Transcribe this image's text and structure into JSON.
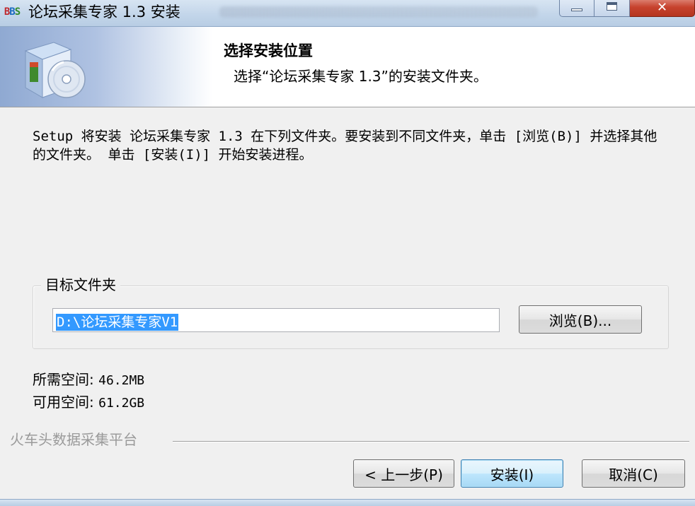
{
  "window": {
    "icon_text": [
      "B",
      "B",
      "S"
    ],
    "title": "论坛采集专家 1.3 安装"
  },
  "header": {
    "title": "选择安装位置",
    "subtitle": "选择“论坛采集专家 1.3”的安装文件夹。"
  },
  "intro_text": "Setup 将安装 论坛采集专家 1.3 在下列文件夹。要安装到不同文件夹，单击 [浏览(B)] 并选择其他的文件夹。 单击 [安装(I)] 开始安装进程。",
  "destination": {
    "group_label": "目标文件夹",
    "path_value": "D:\\论坛采集专家V1",
    "browse_label": "浏览(B)..."
  },
  "space": {
    "required_label": "所需空间: ",
    "required_value": "46.2MB",
    "available_label": "可用空间: ",
    "available_value": "61.2GB"
  },
  "brand_text": "火车头数据采集平台",
  "buttons": {
    "back": "< 上一步(P)",
    "install": "安装(I)",
    "cancel": "取消(C)"
  },
  "colors": {
    "selection": "#3399ff",
    "close_button": "#c7432e"
  }
}
